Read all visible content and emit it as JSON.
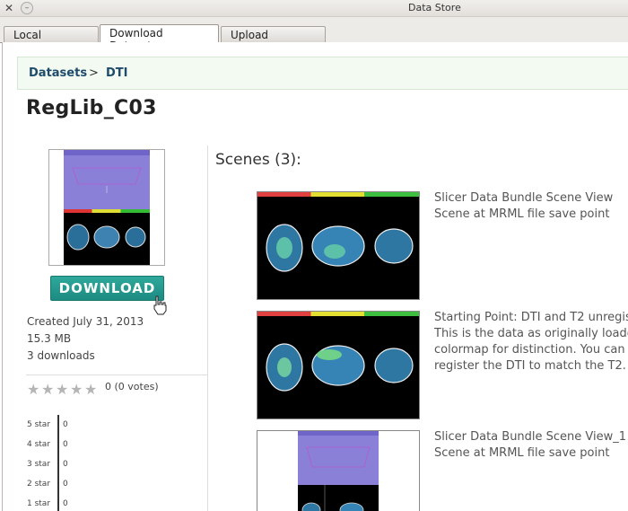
{
  "window": {
    "title": "Data Store"
  },
  "tabs": [
    {
      "label": "Local Datasets"
    },
    {
      "label": "Download Datasets"
    },
    {
      "label": "Upload Datasets"
    }
  ],
  "breadcrumb": {
    "root": "Datasets",
    "separator": ">",
    "current": "DTI"
  },
  "dataset": {
    "title": "RegLib_C03",
    "download_label": "DOWNLOAD",
    "created": "Created July 31, 2013",
    "size": "15.3 MB",
    "downloads": "3 downloads",
    "votes": "0 (0 votes)",
    "rating": 0,
    "histogram": [
      {
        "label": "5 star",
        "value": "0"
      },
      {
        "label": "4 star",
        "value": "0"
      },
      {
        "label": "3 star",
        "value": "0"
      },
      {
        "label": "2 star",
        "value": "0"
      },
      {
        "label": "1 star",
        "value": "0"
      }
    ]
  },
  "scenes": {
    "title": "Scenes (3):",
    "items": [
      {
        "line1": "Slicer Data Bundle Scene View",
        "line2": "Scene at MRML file save point",
        "line3": "",
        "line4": ""
      },
      {
        "line1": "Starting Point: DTI and T2 unregis",
        "line2": "This is the data as originally loade",
        "line3": "colormap for distinction. You can",
        "line4": "register the DTI to match the T2."
      },
      {
        "line1": "Slicer Data Bundle Scene View_1",
        "line2": "Scene at MRML file save point",
        "line3": "",
        "line4": ""
      }
    ]
  },
  "colors": {
    "accent": "#1d8b82",
    "breadcrumb_text": "#1f4b6b",
    "breadcrumb_bg": "#f2faf2"
  }
}
